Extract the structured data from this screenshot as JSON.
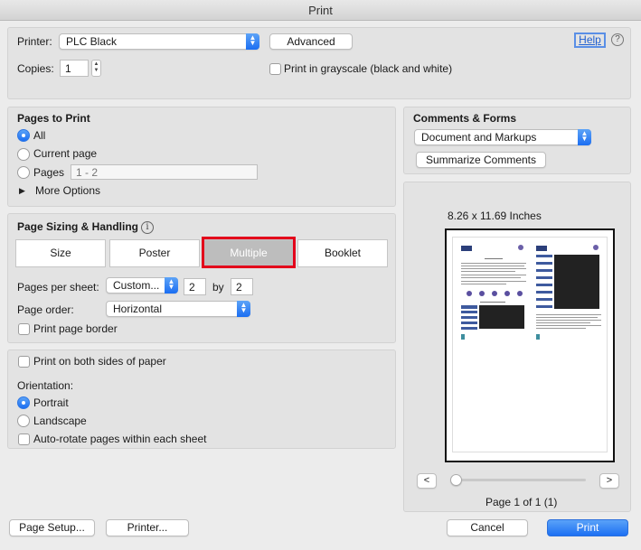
{
  "window": {
    "title": "Print"
  },
  "top": {
    "printer_label": "Printer:",
    "printer_value": "PLC Black",
    "advanced_button": "Advanced",
    "help_link": "Help",
    "help_icon": "?",
    "copies_label": "Copies:",
    "copies_value": "1",
    "grayscale_label": "Print in grayscale (black and white)"
  },
  "pages_to_print": {
    "title": "Pages to Print",
    "all": "All",
    "current_page": "Current page",
    "pages": "Pages",
    "pages_placeholder": "1 - 2",
    "more_options": "More Options",
    "selected": "All"
  },
  "page_sizing": {
    "title": "Page Sizing & Handling",
    "info_icon": "i",
    "tabs": [
      "Size",
      "Poster",
      "Multiple",
      "Booklet"
    ],
    "selected_tab": "Multiple",
    "pages_per_sheet_label": "Pages per sheet:",
    "pages_per_sheet_value": "Custom...",
    "cols_value": "2",
    "by_label": "by",
    "rows_value": "2",
    "page_order_label": "Page order:",
    "page_order_value": "Horizontal",
    "print_border_label": "Print page border"
  },
  "orientation_panel": {
    "both_sides_label": "Print on both sides of paper",
    "orientation_label": "Orientation:",
    "portrait": "Portrait",
    "landscape": "Landscape",
    "selected": "Portrait",
    "auto_rotate_label": "Auto-rotate pages within each sheet"
  },
  "comments_forms": {
    "title": "Comments & Forms",
    "value": "Document and Markups",
    "summarize_button": "Summarize Comments"
  },
  "preview": {
    "size_label": "8.26 x 11.69 Inches",
    "prev_button": "<",
    "next_button": ">",
    "page_status": "Page 1 of 1 (1)",
    "slider_position": 0
  },
  "bottom": {
    "page_setup_button": "Page Setup...",
    "printer_button": "Printer...",
    "cancel_button": "Cancel",
    "print_button": "Print"
  },
  "colors": {
    "accent": "#1c6ff3",
    "highlight_border": "#e3001b",
    "help_link": "#1f5fd1"
  }
}
